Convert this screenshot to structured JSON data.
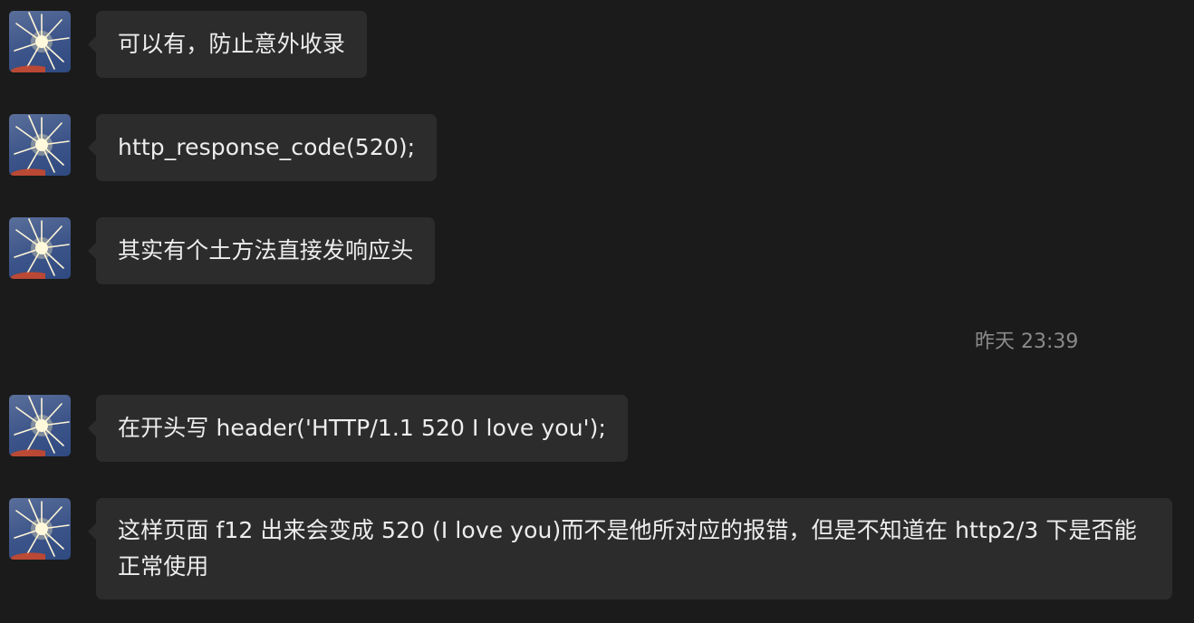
{
  "messages": [
    {
      "text": "可以有，防止意外收录"
    },
    {
      "text": "http_response_code(520);"
    },
    {
      "text": "其实有个土方法直接发响应头"
    },
    {
      "text": "在开头写 header('HTTP/1.1 520 I love you');"
    },
    {
      "text": "这样页面 f12 出来会变成 520 (I love you)而不是他所对应的报错，但是不知道在 http2/3 下是否能正常使用"
    }
  ],
  "timestamp": "昨天 23:39",
  "colors": {
    "background": "#1b1b1b",
    "bubble": "#2c2c2c",
    "text": "#ededed",
    "timestamp": "#8a8a8a"
  },
  "icons": {
    "avatar": "sparkler-photo-avatar"
  }
}
